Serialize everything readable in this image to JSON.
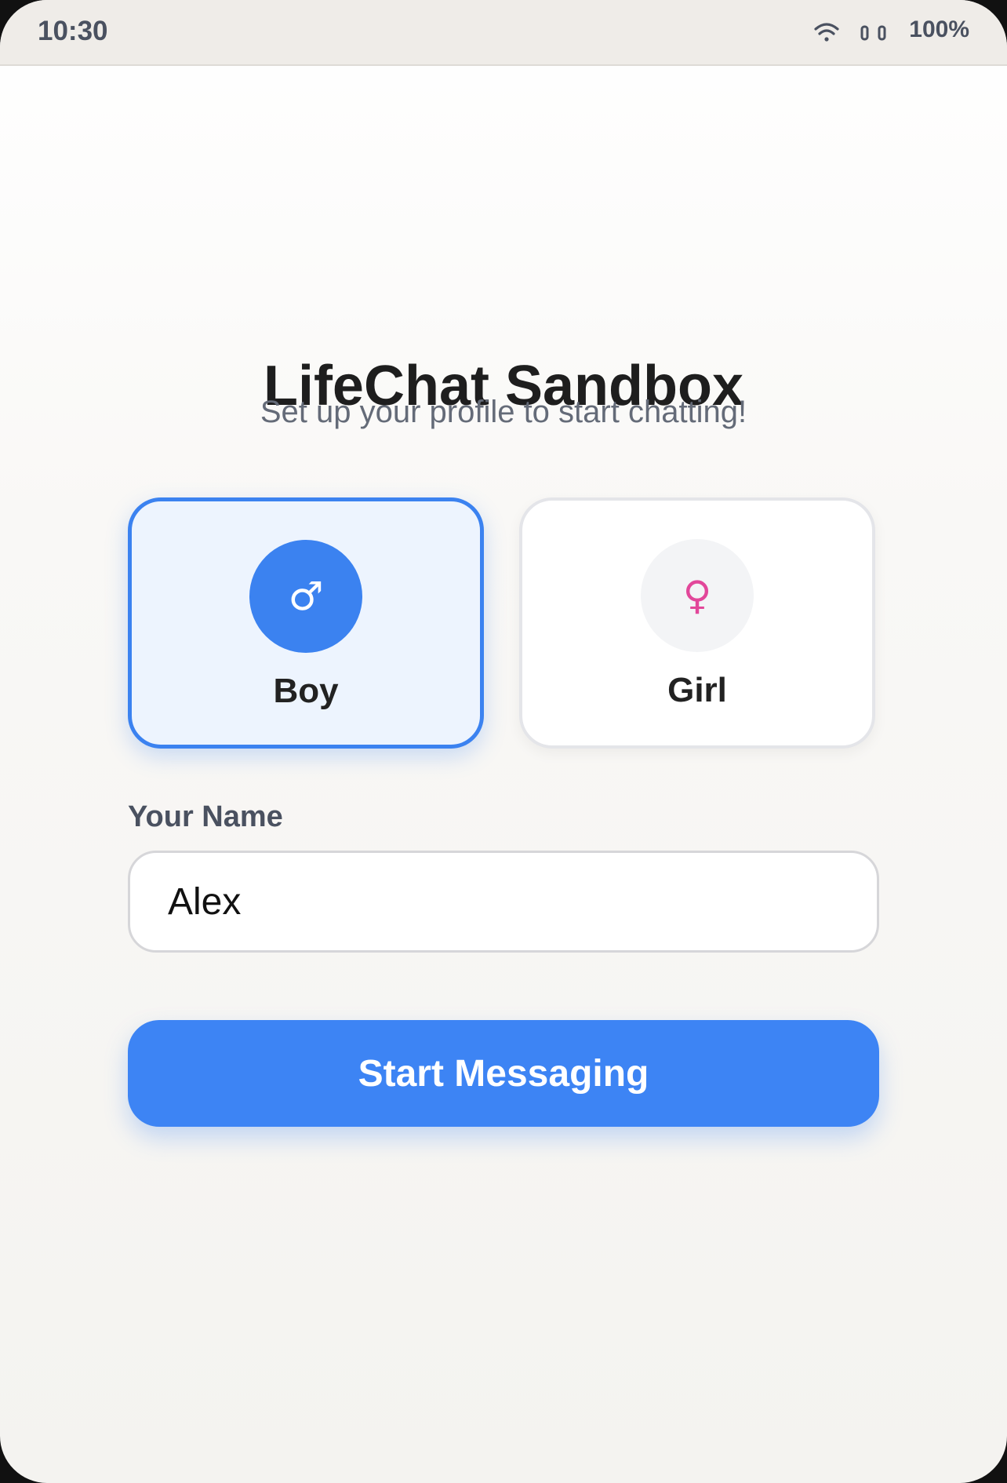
{
  "status_bar": {
    "time": "10:30",
    "wifi_icon": "wifi-icon",
    "signal_icon": "signal-icon",
    "battery": "100%"
  },
  "header": {
    "title": "LifeChat Sandbox",
    "subtitle": "Set up your profile to start chatting!"
  },
  "gender": {
    "selected": "boy",
    "options": [
      {
        "id": "boy",
        "label": "Boy",
        "icon": "♂",
        "icon_name": "male-symbol-icon",
        "accent": "#3b82f0"
      },
      {
        "id": "girl",
        "label": "Girl",
        "icon": "♀",
        "icon_name": "female-symbol-icon",
        "accent": "#e2479a"
      }
    ]
  },
  "name_field": {
    "label": "Your Name",
    "value": "Alex"
  },
  "start_button": {
    "label": "Start Messaging",
    "color": "#3d84f4"
  }
}
